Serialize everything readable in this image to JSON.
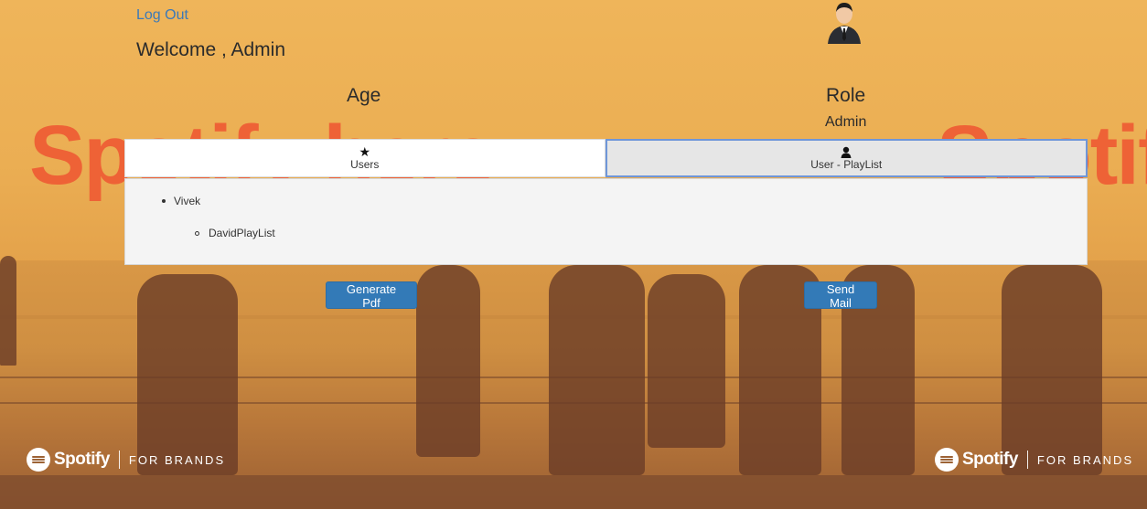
{
  "header": {
    "logout_label": "Log Out",
    "welcome_text": "Welcome , Admin"
  },
  "profile": {
    "age_label": "Age",
    "role_label": "Role",
    "role_value": "Admin"
  },
  "tabs": [
    {
      "label": "Users",
      "icon": "star-icon"
    },
    {
      "label": "User - PlayList",
      "icon": "user-icon"
    }
  ],
  "panel": {
    "user_name": "Vivek",
    "playlist_name": "DavidPlayList"
  },
  "actions": {
    "generate_pdf_label": "Generate Pdf",
    "send_mail_label": "Send Mail"
  },
  "background": {
    "watermark_left": "Spotify here",
    "watermark_right": "Spotif",
    "brand_name": "Spotify",
    "brand_tag": "FOR BRANDS"
  },
  "colors": {
    "link": "#3b79b8",
    "button": "#337ab7",
    "watermark": "#ee6236",
    "active_tab_border": "#6f96d8"
  }
}
